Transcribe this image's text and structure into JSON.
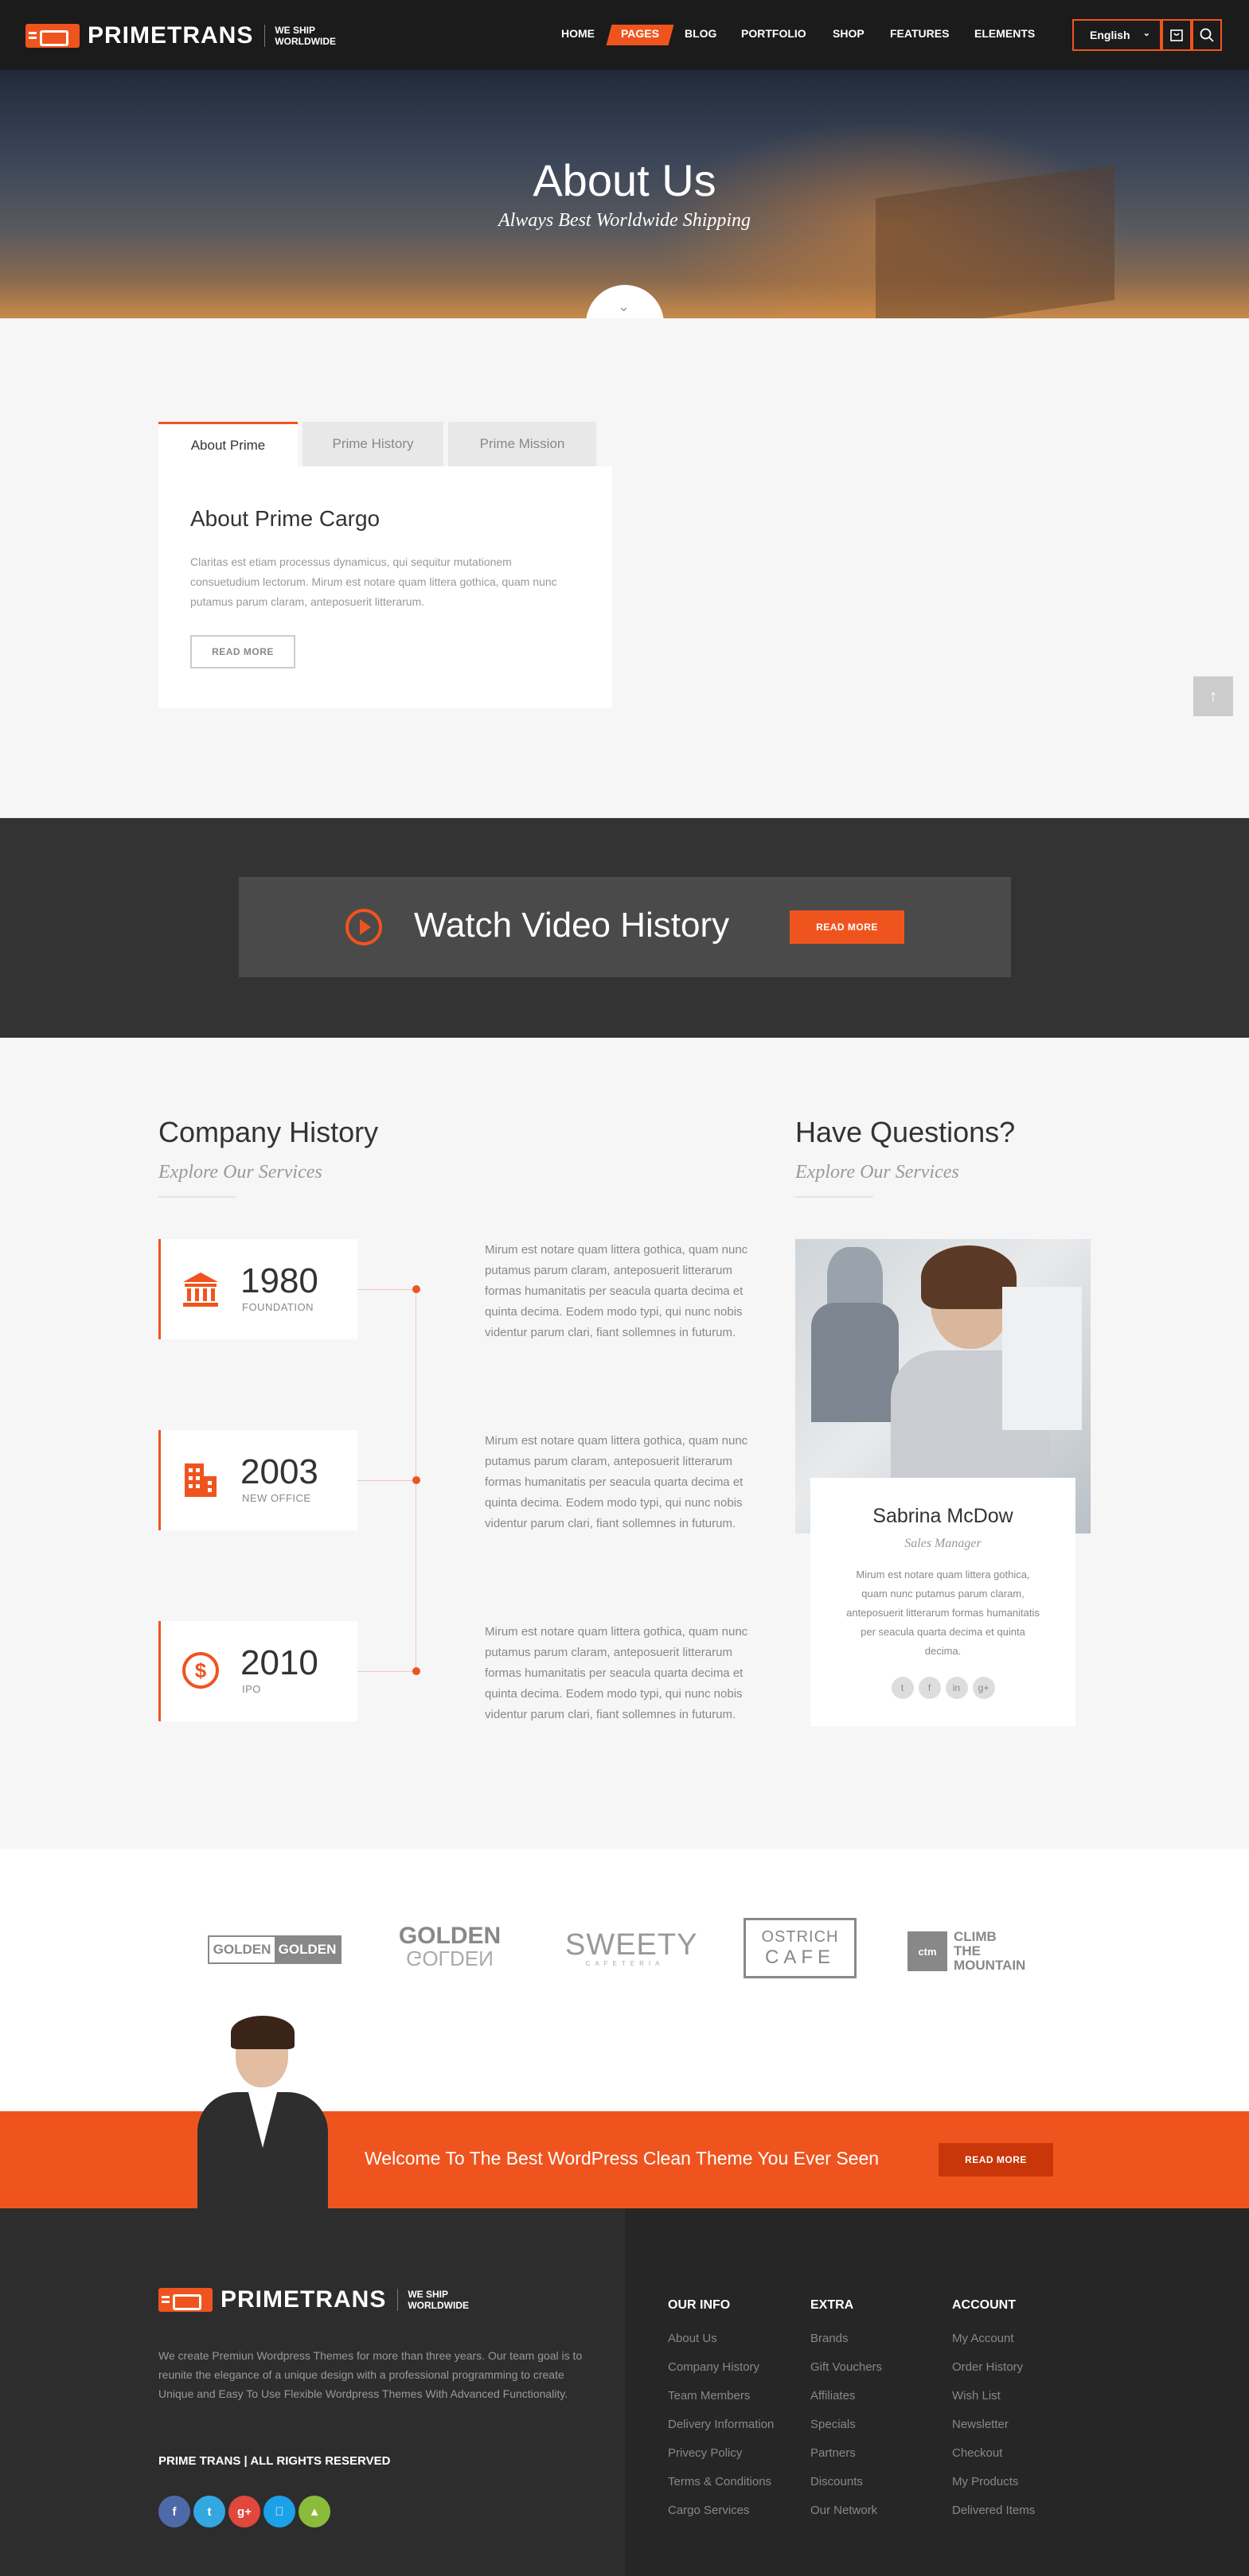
{
  "header": {
    "logo": "PRIMETRANS",
    "tagline_1": "WE SHIP",
    "tagline_2": "WORLDWIDE",
    "nav": [
      "HOME",
      "PAGES",
      "BLOG",
      "PORTFOLIO",
      "SHOP",
      "FEATURES",
      "ELEMENTS"
    ],
    "active_nav": "PAGES",
    "language": "English"
  },
  "hero": {
    "title": "About Us",
    "subtitle": "Always Best Worldwide Shipping"
  },
  "tabs": {
    "items": [
      "About Prime",
      "Prime History",
      "Prime Mission"
    ],
    "active": "About Prime",
    "card_title": "About Prime Cargo",
    "card_text": "Claritas est etiam processus dynamicus, qui sequitur mutationem consuetudium lectorum. Mirum est notare quam littera gothica, quam nunc putamus parum claram, anteposuerit litterarum.",
    "read_more": "READ MORE"
  },
  "video": {
    "title": "Watch Video History",
    "button": "READ MORE"
  },
  "history": {
    "title": "Company History",
    "subtitle": "Explore Our Services",
    "items": [
      {
        "year": "1980",
        "label": "FOUNDATION",
        "icon": "bank-icon",
        "text": "Mirum est notare quam littera gothica, quam nunc putamus parum claram, anteposuerit litterarum formas humanitatis per seacula quarta decima et quinta decima. Eodem modo typi, qui nunc nobis videntur parum clari, fiant sollemnes in futurum."
      },
      {
        "year": "2003",
        "label": "NEW OFFICE",
        "icon": "building-icon",
        "text": "Mirum est notare quam littera gothica, quam nunc putamus parum claram, anteposuerit litterarum formas humanitatis per seacula quarta decima et quinta decima. Eodem modo typi, qui nunc nobis videntur parum clari, fiant sollemnes in futurum."
      },
      {
        "year": "2010",
        "label": "IPO",
        "icon": "dollar-icon",
        "text": "Mirum est notare quam littera gothica, quam nunc putamus parum claram, anteposuerit litterarum formas humanitatis per seacula quarta decima et quinta decima. Eodem modo typi, qui nunc nobis videntur parum clari, fiant sollemnes in futurum."
      }
    ]
  },
  "questions": {
    "title": "Have Questions?",
    "subtitle": "Explore Our Services",
    "name": "Sabrina McDow",
    "role": "Sales Manager",
    "text": "Mirum est notare quam littera gothica, quam nunc putamus parum claram, anteposuerit litterarum formas humanitatis per seacula quarta decima et quinta decima."
  },
  "brands": {
    "b1a": "GOLDEN",
    "b1b": "GOLDEN",
    "b2a": "GOLDEN",
    "b2b": "GOLDEN",
    "b3a": "SWEETY",
    "b3b": "CAFETERIA",
    "b4a": "OSTRICH",
    "b4b": "CAFE",
    "b5_badge": "ctm",
    "b5_line1": "CLIMB",
    "b5_line2": "THE",
    "b5_line3": "MOUNTAIN"
  },
  "cta": {
    "text": "Welcome To The Best WordPress Clean Theme You Ever Seen",
    "button": "READ MORE"
  },
  "footer": {
    "about": "We create Premiun Wordpress Themes for more than three years. Our team goal is to reunite the elegance of a unique design with a professional programming to create Unique and Easy To Use Flexible Wordpress Themes With Advanced Functionality.",
    "rights": "PRIME TRANS | ALL RIGHTS RESERVED",
    "social": [
      "f",
      "t",
      "g+",
      "",
      ""
    ],
    "col1": {
      "title": "OUR INFO",
      "links": [
        "About Us",
        "Company History",
        "Team Members",
        "Delivery Information",
        "Privecy Policy",
        "Terms & Conditions",
        "Cargo Services"
      ]
    },
    "col2": {
      "title": "EXTRA",
      "links": [
        "Brands",
        "Gift Vouchers",
        "Affiliates",
        "Specials",
        "Partners",
        "Discounts",
        "Our Network"
      ]
    },
    "col3": {
      "title": "ACCOUNT",
      "links": [
        "My Account",
        "Order History",
        "Wish List",
        "Newsletter",
        "Checkout",
        "My Products",
        "Delivered Items"
      ]
    }
  },
  "colors": {
    "accent": "#f0541e",
    "dark": "#1b1b1b",
    "footer": "#2a2a2a"
  }
}
